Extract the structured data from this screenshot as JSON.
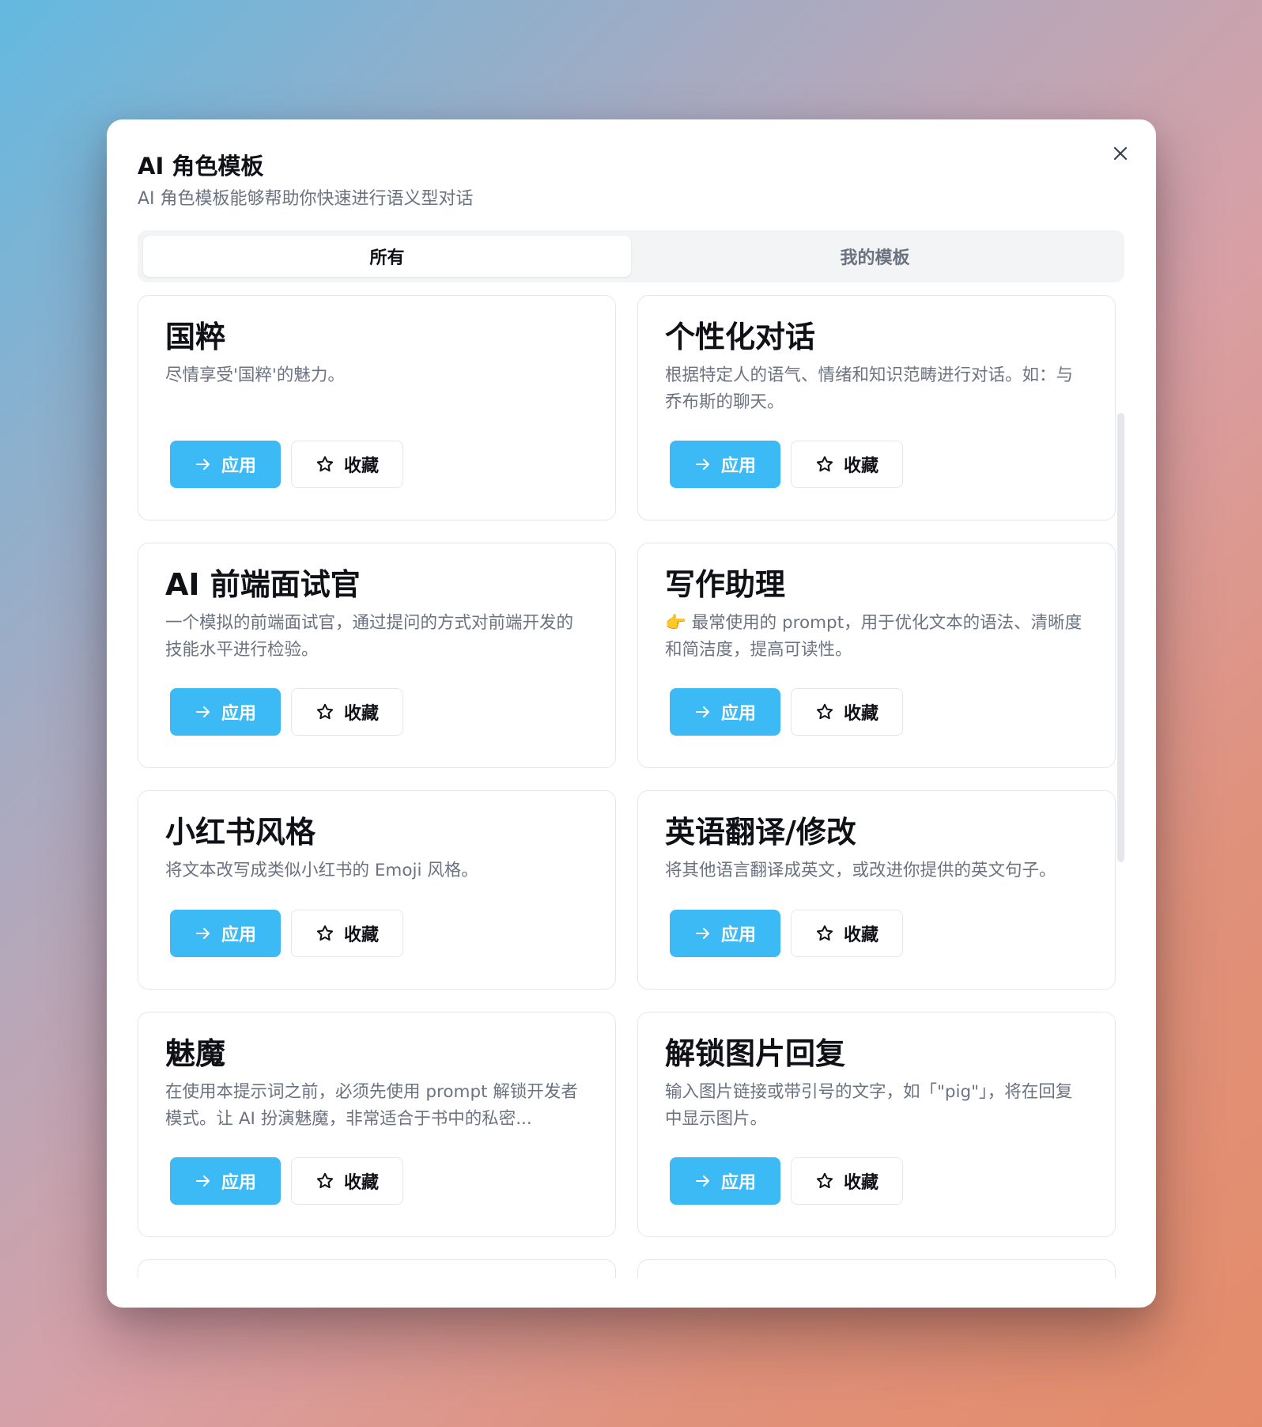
{
  "dialog": {
    "title": "AI 角色模板",
    "subtitle": "AI 角色模板能够帮助你快速进行语义型对话"
  },
  "tabs": [
    {
      "label": "所有",
      "active": true
    },
    {
      "label": "我的模板",
      "active": false
    }
  ],
  "actions": {
    "apply_label": "应用",
    "favorite_label": "收藏"
  },
  "templates": [
    {
      "title": "国粹",
      "description": "尽情享受'国粹'的魅力。"
    },
    {
      "title": "个性化对话",
      "description": "根据特定人的语气、情绪和知识范畴进行对话。如：与乔布斯的聊天。"
    },
    {
      "title": "AI 前端面试官",
      "description": "一个模拟的前端面试官，通过提问的方式对前端开发的技能水平进行检验。"
    },
    {
      "title": "写作助理",
      "description": "👉 最常使用的 prompt，用于优化文本的语法、清晰度和简洁度，提高可读性。"
    },
    {
      "title": "小红书风格",
      "description": "将文本改写成类似小红书的 Emoji 风格。"
    },
    {
      "title": "英语翻译/修改",
      "description": "将其他语言翻译成英文，或改进你提供的英文句子。"
    },
    {
      "title": "魅魔",
      "description": "在使用本提示词之前，必须先使用 prompt 解锁开发者模式。让 AI 扮演魅魔，非常适合于书中的私密..."
    },
    {
      "title": "解锁图片回复",
      "description": "输入图片链接或带引号的文字，如「\"pig\"」，将在回复中显示图片。"
    }
  ],
  "colors": {
    "accent": "#3cbaf5",
    "title_text": "#0f1117",
    "muted_text": "#6b7280",
    "border": "#e5e7eb"
  },
  "icons": {
    "close": "close-icon",
    "apply": "arrow-right-icon",
    "favorite": "star-icon"
  }
}
